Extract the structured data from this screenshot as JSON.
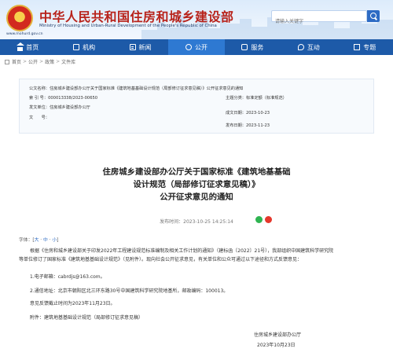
{
  "header": {
    "site_title": "中华人民共和国住房和城乡建设部",
    "site_subtitle": "Ministry of Housing and Urban-Rural Development of the People's Republic of China",
    "site_url": "www.mohurd.gov.cn",
    "search_placeholder": "请输入关键字"
  },
  "nav": {
    "items": [
      {
        "label": "首页",
        "icon": "home-icon"
      },
      {
        "label": "机构",
        "icon": "org-icon"
      },
      {
        "label": "新闻",
        "icon": "news-icon"
      },
      {
        "label": "公开",
        "icon": "open-icon",
        "active": true
      },
      {
        "label": "服务",
        "icon": "service-icon"
      },
      {
        "label": "互动",
        "icon": "interact-icon"
      },
      {
        "label": "专题",
        "icon": "special-icon"
      }
    ]
  },
  "breadcrumb": {
    "items": [
      "首页",
      "公开",
      "政策",
      "文件库"
    ],
    "separator": ">"
  },
  "meta": {
    "title_key": "公文名称：",
    "title_value": "住房城乡建设部办公厅关于国家标准《建筑地基基础设计规范（局部修订征求意见稿）》公开征求意见的通知",
    "index_key": "索 引 号：",
    "index_value": "000013338/2023-00650",
    "category_key": "主题分类：",
    "category_value": "标准定额（标准规范）",
    "issuer_key": "发文单位：",
    "issuer_value": "住房城乡建设部办公厅",
    "written_key": "成文日期：",
    "written_value": "2023-10-23",
    "number_key": "文　　号：",
    "number_value": "",
    "published_key": "发布日期：",
    "published_value": "2023-11-23"
  },
  "article": {
    "title_line1": "住房城乡建设部办公厅关于国家标准《建筑地基基础",
    "title_line2": "设计规范（局部修订征求意见稿）》",
    "title_line3": "公开征求意见的通知",
    "pub_time": "发布时间：2023-10-25 14:25:14",
    "font_size_label": "字体：[",
    "font_large": "大",
    "font_mid": "中",
    "font_small": "小",
    "font_end": "]",
    "para1_line1": "根据《住房和城乡建设部关于印发2022年工程建设规范标准编制及相关工作计划的通知》（建标函〔2022〕21号），我部组织中国建筑科学研究院",
    "para1_line2": "等单位修订了国家标准《建筑地基基础设计规范》（见附件）。现向社会公开征求意见，有关单位和公众可通过以下途径和方式反馈意见：",
    "para2": "1.电子邮箱：cabrdjs@163.com。",
    "para3": "2.通信地址：北京市朝阳区北三环东路30号中国建筑科学研究院地基所，邮政编码：100013。",
    "para4": "意见反馈截止时间为2023年11月23日。",
    "attachment": "附件：建筑地基基础设计规范（局部修订征求意见稿）",
    "sign_org": "住房城乡建设部办公厅",
    "sign_date": "2023年10月23日"
  }
}
